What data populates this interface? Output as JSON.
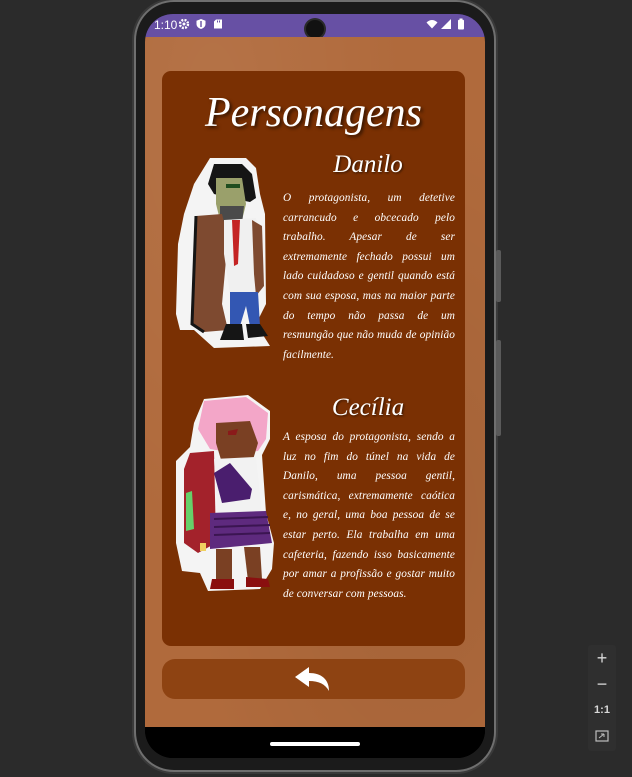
{
  "status_bar": {
    "time": "1:10",
    "left_icons": [
      "gear-icon",
      "shield-icon",
      "sd-card-icon"
    ],
    "right_icons": [
      "wifi-icon",
      "signal-icon",
      "battery-icon"
    ]
  },
  "page": {
    "title": "Personagens"
  },
  "characters": [
    {
      "name": "Danilo",
      "description": "O protagonista, um detetive carrancudo e obcecado pelo trabalho. Apesar de ser extremamente fechado possui um lado cuidadoso e gentil quando está com sua esposa, mas na maior parte do tempo não passa de um resmungão que não muda de opinião facilmente."
    },
    {
      "name": "Cecília",
      "description": "A esposa do protagonista, sendo a luz no fim do túnel na vida de Danilo, uma pessoa gentil, carismática, extremamente caótica e, no geral, uma boa pessoa de se estar perto. Ela trabalha em uma cafeteria, fazendo isso basicamente por amar a profissão e gostar muito de conversar com pessoas."
    }
  ],
  "back_button": {
    "icon": "back-arrow-icon"
  },
  "emulator_zoom": {
    "zoom_in": "+",
    "zoom_out": "−",
    "actual_size": "1:1",
    "fit_icon": "fit-screen-icon"
  },
  "colors": {
    "status_bar": "#6750a4",
    "background": "#b06a3c",
    "card": "#7a3003",
    "button": "#8e4312",
    "text": "#ffffff"
  }
}
